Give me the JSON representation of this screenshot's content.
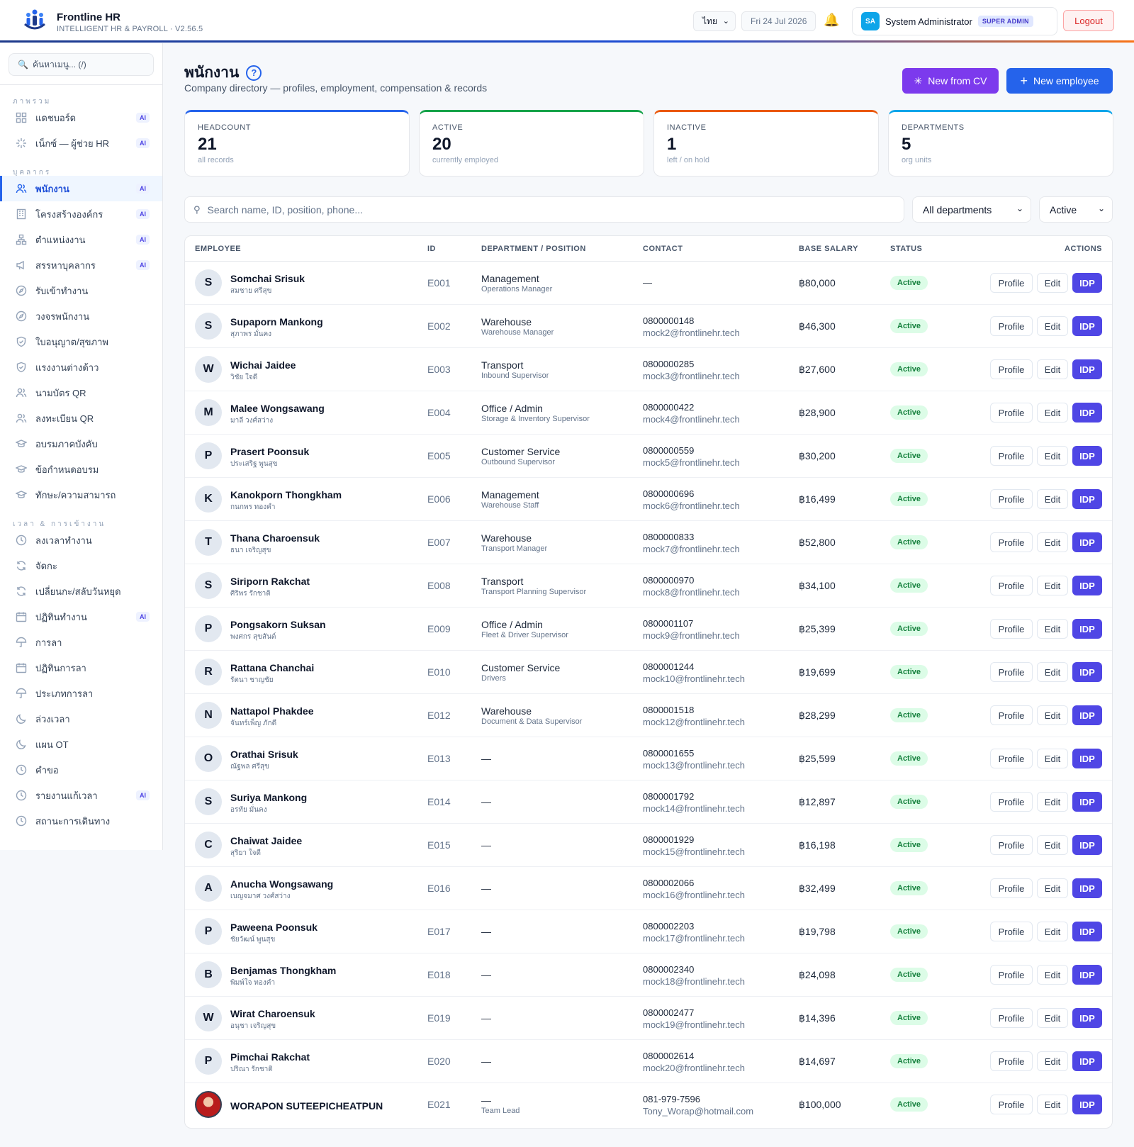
{
  "header": {
    "brand_name": "Frontline HR",
    "brand_sub": "INTELLIGENT HR & PAYROLL · V2.56.5",
    "language": "ไทย",
    "date": "Fri 24 Jul 2026",
    "user_initials": "SA",
    "user_name": "System Administrator",
    "user_role": "SUPER ADMIN",
    "logout_label": "Logout",
    "bell_icon": "bell-icon"
  },
  "sidebar": {
    "search_placeholder": "ค้นหาเมนู... (/)",
    "sections": [
      {
        "label": "ภาพรวม",
        "items": [
          {
            "label": "แดชบอร์ด",
            "icon": "grid-icon",
            "ai": "AI"
          },
          {
            "label": "เน็กซ์ — ผู้ช่วย HR",
            "icon": "sparkle-icon",
            "ai": "AI"
          }
        ]
      },
      {
        "label": "บุคลากร",
        "items": [
          {
            "label": "พนักงาน",
            "icon": "users-icon",
            "ai": "AI",
            "active": true
          },
          {
            "label": "โครงสร้างองค์กร",
            "icon": "building-icon",
            "ai": "AI"
          },
          {
            "label": "ตำแหน่งงาน",
            "icon": "org-icon",
            "ai": "AI"
          },
          {
            "label": "สรรหาบุคลากร",
            "icon": "megaphone-icon",
            "ai": "AI"
          },
          {
            "label": "รับเข้าทำงาน",
            "icon": "compass-icon",
            "ai": ""
          },
          {
            "label": "วงจรพนักงาน",
            "icon": "compass-icon",
            "ai": ""
          },
          {
            "label": "ใบอนุญาต/สุขภาพ",
            "icon": "shield-icon",
            "ai": ""
          },
          {
            "label": "แรงงานต่างด้าว",
            "icon": "shield-icon",
            "ai": ""
          },
          {
            "label": "นามบัตร QR",
            "icon": "users-icon",
            "ai": ""
          },
          {
            "label": "ลงทะเบียน QR",
            "icon": "users-icon",
            "ai": ""
          },
          {
            "label": "อบรมภาคบังคับ",
            "icon": "graduation-icon",
            "ai": ""
          },
          {
            "label": "ข้อกำหนดอบรม",
            "icon": "graduation-icon",
            "ai": ""
          },
          {
            "label": "ทักษะ/ความสามารถ",
            "icon": "graduation-icon",
            "ai": ""
          }
        ]
      },
      {
        "label": "เวลา & การเข้างาน",
        "items": [
          {
            "label": "ลงเวลาทำงาน",
            "icon": "clock-icon",
            "ai": ""
          },
          {
            "label": "จัดกะ",
            "icon": "refresh-icon",
            "ai": ""
          },
          {
            "label": "เปลี่ยนกะ/สลับวันหยุด",
            "icon": "refresh-icon",
            "ai": ""
          },
          {
            "label": "ปฏิทินทำงาน",
            "icon": "calendar-icon",
            "ai": "AI"
          },
          {
            "label": "การลา",
            "icon": "umbrella-icon",
            "ai": ""
          },
          {
            "label": "ปฏิทินการลา",
            "icon": "calendar-icon",
            "ai": ""
          },
          {
            "label": "ประเภทการลา",
            "icon": "umbrella-icon",
            "ai": ""
          },
          {
            "label": "ล่วงเวลา",
            "icon": "moon-icon",
            "ai": ""
          },
          {
            "label": "แผน OT",
            "icon": "moon-icon",
            "ai": ""
          },
          {
            "label": "คำขอ",
            "icon": "clock-icon",
            "ai": ""
          },
          {
            "label": "รายงานแก้เวลา",
            "icon": "clock-icon",
            "ai": "AI"
          },
          {
            "label": "สถานะการเดินทาง",
            "icon": "clock-icon",
            "ai": ""
          }
        ]
      }
    ]
  },
  "main": {
    "title": "พนักงาน",
    "subtitle": "Company directory — profiles, employment, compensation & records",
    "new_from_cv": "New from CV",
    "new_employee": "New employee",
    "kpis": [
      {
        "label": "HEADCOUNT",
        "value": "21",
        "sub": "all records",
        "color": "#2563eb"
      },
      {
        "label": "ACTIVE",
        "value": "20",
        "sub": "currently employed",
        "color": "#16a34a"
      },
      {
        "label": "INACTIVE",
        "value": "1",
        "sub": "left / on hold",
        "color": "#ea580c"
      },
      {
        "label": "DEPARTMENTS",
        "value": "5",
        "sub": "org units",
        "color": "#0ea5e9"
      }
    ],
    "search_placeholder": "Search name, ID, position, phone...",
    "dept_filter": "All departments",
    "status_filter": "Active",
    "columns": {
      "employee": "EMPLOYEE",
      "id": "ID",
      "dept": "DEPARTMENT / POSITION",
      "contact": "CONTACT",
      "salary": "BASE SALARY",
      "status": "STATUS",
      "actions": "ACTIONS"
    },
    "btn_profile": "Profile",
    "btn_edit": "Edit",
    "btn_idp": "IDP",
    "employees": [
      {
        "initial": "S",
        "name": "Somchai Srisuk",
        "name_th": "สมชาย ศรีสุข",
        "id": "E001",
        "dept": "Management",
        "pos": "Operations Manager",
        "phone": "—",
        "email": "",
        "salary": "฿80,000",
        "status": "Active"
      },
      {
        "initial": "S",
        "name": "Supaporn Mankong",
        "name_th": "สุภาพร มั่นคง",
        "id": "E002",
        "dept": "Warehouse",
        "pos": "Warehouse Manager",
        "phone": "0800000148",
        "email": "mock2@frontlinehr.tech",
        "salary": "฿46,300",
        "status": "Active"
      },
      {
        "initial": "W",
        "name": "Wichai Jaidee",
        "name_th": "วิชัย ใจดี",
        "id": "E003",
        "dept": "Transport",
        "pos": "Inbound Supervisor",
        "phone": "0800000285",
        "email": "mock3@frontlinehr.tech",
        "salary": "฿27,600",
        "status": "Active"
      },
      {
        "initial": "M",
        "name": "Malee Wongsawang",
        "name_th": "มาลี วงศ์สว่าง",
        "id": "E004",
        "dept": "Office / Admin",
        "pos": "Storage & Inventory Supervisor",
        "phone": "0800000422",
        "email": "mock4@frontlinehr.tech",
        "salary": "฿28,900",
        "status": "Active"
      },
      {
        "initial": "P",
        "name": "Prasert Poonsuk",
        "name_th": "ประเสริฐ พูนสุข",
        "id": "E005",
        "dept": "Customer Service",
        "pos": "Outbound Supervisor",
        "phone": "0800000559",
        "email": "mock5@frontlinehr.tech",
        "salary": "฿30,200",
        "status": "Active"
      },
      {
        "initial": "K",
        "name": "Kanokporn Thongkham",
        "name_th": "กนกพร ทองคำ",
        "id": "E006",
        "dept": "Management",
        "pos": "Warehouse Staff",
        "phone": "0800000696",
        "email": "mock6@frontlinehr.tech",
        "salary": "฿16,499",
        "status": "Active"
      },
      {
        "initial": "T",
        "name": "Thana Charoensuk",
        "name_th": "ธนา เจริญสุข",
        "id": "E007",
        "dept": "Warehouse",
        "pos": "Transport Manager",
        "phone": "0800000833",
        "email": "mock7@frontlinehr.tech",
        "salary": "฿52,800",
        "status": "Active"
      },
      {
        "initial": "S",
        "name": "Siriporn Rakchat",
        "name_th": "ศิริพร รักชาติ",
        "id": "E008",
        "dept": "Transport",
        "pos": "Transport Planning Supervisor",
        "phone": "0800000970",
        "email": "mock8@frontlinehr.tech",
        "salary": "฿34,100",
        "status": "Active"
      },
      {
        "initial": "P",
        "name": "Pongsakorn Suksan",
        "name_th": "พงศกร สุขสันต์",
        "id": "E009",
        "dept": "Office / Admin",
        "pos": "Fleet & Driver Supervisor",
        "phone": "0800001107",
        "email": "mock9@frontlinehr.tech",
        "salary": "฿25,399",
        "status": "Active"
      },
      {
        "initial": "R",
        "name": "Rattana Chanchai",
        "name_th": "รัตนา ชาญชัย",
        "id": "E010",
        "dept": "Customer Service",
        "pos": "Drivers",
        "phone": "0800001244",
        "email": "mock10@frontlinehr.tech",
        "salary": "฿19,699",
        "status": "Active"
      },
      {
        "initial": "N",
        "name": "Nattapol Phakdee",
        "name_th": "จันทร์เพ็ญ ภักดี",
        "id": "E012",
        "dept": "Warehouse",
        "pos": "Document & Data Supervisor",
        "phone": "0800001518",
        "email": "mock12@frontlinehr.tech",
        "salary": "฿28,299",
        "status": "Active"
      },
      {
        "initial": "O",
        "name": "Orathai Srisuk",
        "name_th": "ณัฐพล ศรีสุข",
        "id": "E013",
        "dept": "—",
        "pos": "",
        "phone": "0800001655",
        "email": "mock13@frontlinehr.tech",
        "salary": "฿25,599",
        "status": "Active"
      },
      {
        "initial": "S",
        "name": "Suriya Mankong",
        "name_th": "อรทัย มั่นคง",
        "id": "E014",
        "dept": "—",
        "pos": "",
        "phone": "0800001792",
        "email": "mock14@frontlinehr.tech",
        "salary": "฿12,897",
        "status": "Active"
      },
      {
        "initial": "C",
        "name": "Chaiwat Jaidee",
        "name_th": "สุริยา ใจดี",
        "id": "E015",
        "dept": "—",
        "pos": "",
        "phone": "0800001929",
        "email": "mock15@frontlinehr.tech",
        "salary": "฿16,198",
        "status": "Active"
      },
      {
        "initial": "A",
        "name": "Anucha Wongsawang",
        "name_th": "เบญจมาศ วงศ์สว่าง",
        "id": "E016",
        "dept": "—",
        "pos": "",
        "phone": "0800002066",
        "email": "mock16@frontlinehr.tech",
        "salary": "฿32,499",
        "status": "Active"
      },
      {
        "initial": "P",
        "name": "Paweena Poonsuk",
        "name_th": "ชัยวัฒน์ พูนสุข",
        "id": "E017",
        "dept": "—",
        "pos": "",
        "phone": "0800002203",
        "email": "mock17@frontlinehr.tech",
        "salary": "฿19,798",
        "status": "Active"
      },
      {
        "initial": "B",
        "name": "Benjamas Thongkham",
        "name_th": "พิมพ์ใจ ทองคำ",
        "id": "E018",
        "dept": "—",
        "pos": "",
        "phone": "0800002340",
        "email": "mock18@frontlinehr.tech",
        "salary": "฿24,098",
        "status": "Active"
      },
      {
        "initial": "W",
        "name": "Wirat Charoensuk",
        "name_th": "อนุชา เจริญสุข",
        "id": "E019",
        "dept": "—",
        "pos": "",
        "phone": "0800002477",
        "email": "mock19@frontlinehr.tech",
        "salary": "฿14,396",
        "status": "Active"
      },
      {
        "initial": "P",
        "name": "Pimchai Rakchat",
        "name_th": "ปริณา รักชาติ",
        "id": "E020",
        "dept": "—",
        "pos": "",
        "phone": "0800002614",
        "email": "mock20@frontlinehr.tech",
        "salary": "฿14,697",
        "status": "Active"
      },
      {
        "initial": "",
        "photo": true,
        "name": "WORAPON SUTEEPICHEATPUN",
        "name_th": "",
        "id": "E021",
        "dept": "—",
        "pos": "Team Lead",
        "phone": "081-979-7596",
        "email": "Tony_Worap@hotmail.com",
        "salary": "฿100,000",
        "status": "Active"
      }
    ]
  }
}
